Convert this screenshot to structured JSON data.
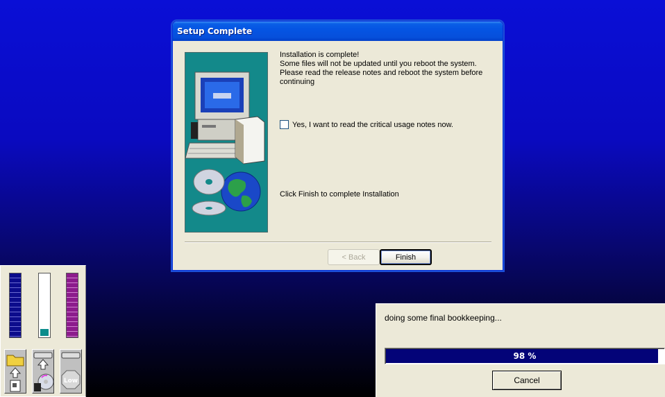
{
  "dialog": {
    "title": "Setup Complete",
    "message_lines": [
      "Installation is complete!",
      "Some files will not be updated until you reboot the system.",
      "Please read the release notes and reboot the system before",
      "continuing"
    ],
    "checkbox_label": "Yes, I want to read the critical usage notes now.",
    "checkbox_checked": false,
    "finish_message": "Click Finish to complete Installation",
    "back_label": "< Back",
    "finish_label": "Finish"
  },
  "meters": {
    "low_label": "Low"
  },
  "progress": {
    "message": "doing some final bookkeeping...",
    "percent": 98,
    "percent_label": "98 %",
    "cancel_label": "Cancel"
  },
  "colors": {
    "desktop_top": "#0a0fd6",
    "desktop_bottom": "#000000",
    "titlebar": "#0554e3",
    "progress_fill": "#030378"
  }
}
